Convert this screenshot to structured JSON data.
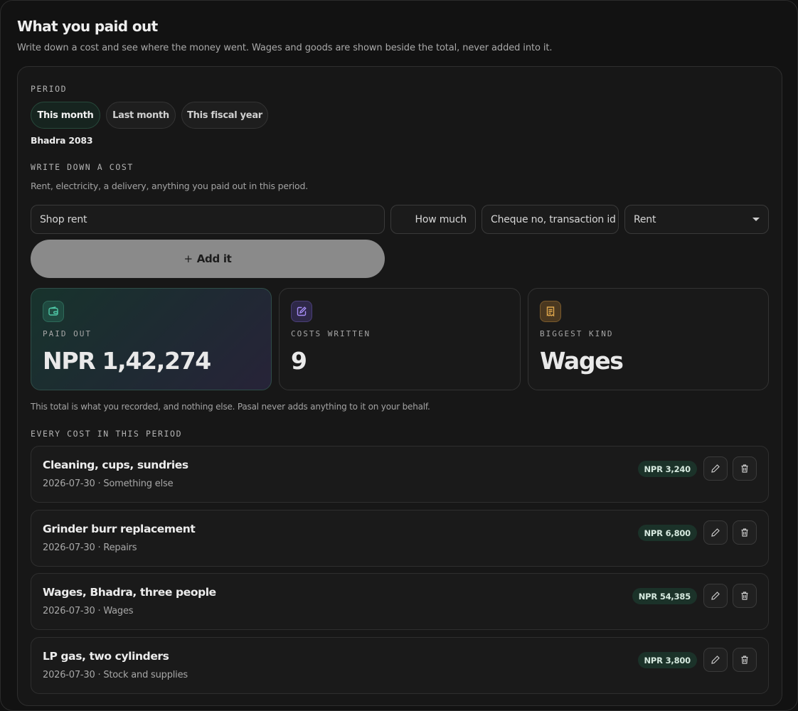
{
  "header": {
    "title": "What you paid out",
    "subtitle": "Write down a cost and see where the money went. Wages and goods are shown beside the total, never added into it."
  },
  "period": {
    "label": "PERIOD",
    "chips": [
      "This month",
      "Last month",
      "This fiscal year"
    ],
    "active": "This month",
    "current": "Bhadra 2083"
  },
  "form": {
    "label": "WRITE DOWN A COST",
    "hint": "Rent, electricity, a delivery, anything you paid out in this period.",
    "description_value": "Shop rent",
    "amount_placeholder": "How much",
    "reference_placeholder": "Cheque no, transaction id",
    "kind_selected": "Rent",
    "add_plus": "+",
    "add_label": "Add it"
  },
  "stats": {
    "paid_out_label": "PAID OUT",
    "paid_out_value": "NPR 1,42,274",
    "costs_label": "COSTS WRITTEN",
    "costs_value": "9",
    "kind_label": "BIGGEST KIND",
    "kind_value": "Wages",
    "disclaimer": "This total is what you recorded, and nothing else. Pasal never adds anything to it on your behalf."
  },
  "icons": {
    "paid_out": "wallet-icon",
    "costs": "notebook-pen-icon",
    "kind": "receipt-icon",
    "edit": "pencil-icon",
    "delete": "trash-icon"
  },
  "colors": {
    "paid_out_icon": "#4fc7a6",
    "costs_icon": "#a58cf5",
    "kind_icon": "#e0a84d",
    "amount_badge_bg": "#1b3229"
  },
  "list": {
    "label": "EVERY COST IN THIS PERIOD",
    "items": [
      {
        "title": "Cleaning, cups, sundries",
        "meta": "2026-07-30 · Something else",
        "amount": "NPR 3,240"
      },
      {
        "title": "Grinder burr replacement",
        "meta": "2026-07-30 · Repairs",
        "amount": "NPR 6,800"
      },
      {
        "title": "Wages, Bhadra, three people",
        "meta": "2026-07-30 · Wages",
        "amount": "NPR 54,385"
      },
      {
        "title": "LP gas, two cylinders",
        "meta": "2026-07-30 · Stock and supplies",
        "amount": "NPR 3,800"
      }
    ]
  }
}
